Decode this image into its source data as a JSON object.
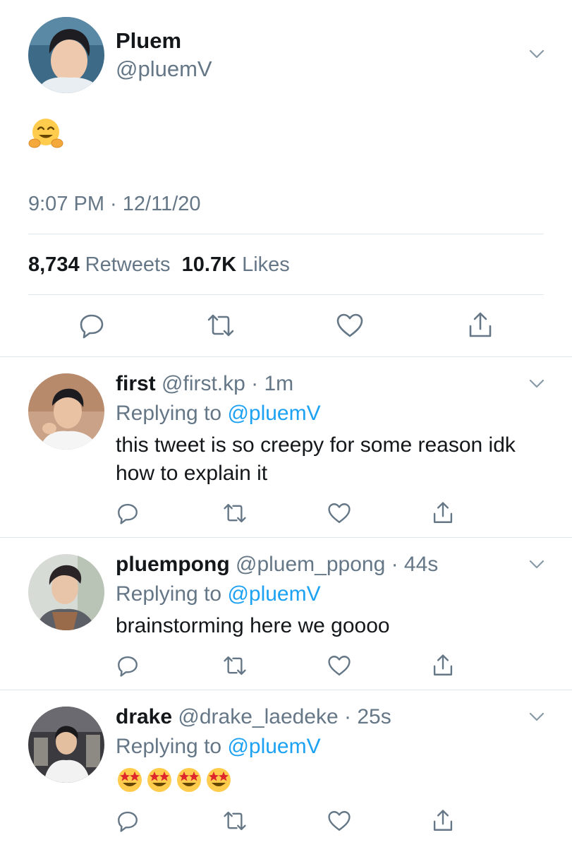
{
  "main_tweet": {
    "display_name": "Pluem",
    "handle": "@pluemV",
    "body_emoji": "hugging-face",
    "timestamp": "9:07 PM · 12/11/20",
    "retweets_count": "8,734",
    "retweets_label": "Retweets",
    "likes_count": "10.7K",
    "likes_label": "Likes"
  },
  "replies": [
    {
      "display_name": "first",
      "meta": "@first.kp · 1m",
      "replying_prefix": "Replying to",
      "replying_mention": "@pluemV",
      "text": "this tweet is so creepy for some reason idk how to explain it"
    },
    {
      "display_name": "pluempong",
      "meta": "@pluem_ppong · 44s",
      "replying_prefix": "Replying to",
      "replying_mention": "@pluemV",
      "text": "brainstorming here we goooo"
    },
    {
      "display_name": "drake",
      "meta": "@drake_laedeke · 25s",
      "replying_prefix": "Replying to",
      "replying_mention": "@pluemV",
      "body_emoji": "star-struck",
      "body_emoji_count": 4
    }
  ],
  "colors": {
    "text": "#14171a",
    "secondary_text": "#657786",
    "mention_blue": "#1da1f2",
    "divider": "#e1e8ed",
    "icon_gray": "#657786"
  },
  "icons": [
    "chevron-down-icon",
    "reply-icon",
    "retweet-icon",
    "like-icon",
    "share-icon"
  ]
}
